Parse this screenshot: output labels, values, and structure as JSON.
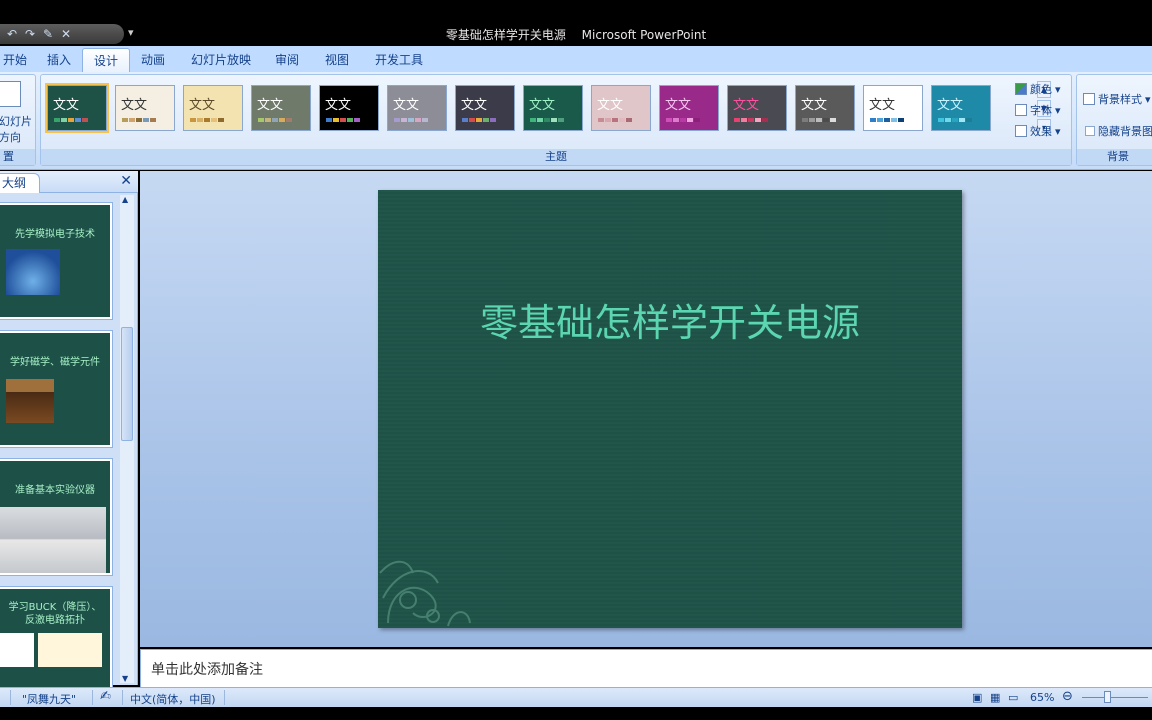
{
  "window": {
    "title_doc": "零基础怎样学开关电源",
    "title_app": "Microsoft PowerPoint"
  },
  "qat": {
    "buttons": [
      "↶",
      "↷",
      "✎",
      "✕"
    ],
    "more": "▾"
  },
  "tabs": [
    "开始",
    "插入",
    "设计",
    "动画",
    "幻灯片放映",
    "审阅",
    "视图",
    "开发工具"
  ],
  "active_tab": "设计",
  "ribbon": {
    "page_setup": {
      "label": "置",
      "button_line1": "幻灯片",
      "button_line2": "方向"
    },
    "themes": {
      "label": "主题",
      "items": [
        {
          "text": "文文",
          "bg": "#1e5247",
          "fg": "#fff",
          "colors": [
            "#39a36c",
            "#7fd1a6",
            "#e4a33c",
            "#5a8fd4",
            "#c04f4f"
          ]
        },
        {
          "text": "文文",
          "bg": "#f4efe2",
          "fg": "#333",
          "colors": [
            "#b89c5c",
            "#cfa46e",
            "#8a6d3b",
            "#7a9bb8",
            "#a67b4f"
          ]
        },
        {
          "text": "文文",
          "bg": "#f3e3b0",
          "fg": "#5a4a2a",
          "colors": [
            "#c9963f",
            "#d7b066",
            "#a77a2c",
            "#e5c17b",
            "#8f6a2d"
          ]
        },
        {
          "text": "文文",
          "bg": "#6f7a6a",
          "fg": "#fff",
          "colors": [
            "#a7c76a",
            "#c5b47a",
            "#8fa5b4",
            "#d4ae5e",
            "#a37d6b"
          ]
        },
        {
          "text": "文文",
          "bg": "#000000",
          "fg": "#fff",
          "colors": [
            "#3d7ac9",
            "#e6c02f",
            "#d04f4f",
            "#57b357",
            "#a45fc4"
          ]
        },
        {
          "text": "文文",
          "bg": "#8d8d98",
          "fg": "#fff",
          "colors": [
            "#a69ccf",
            "#c7b5d6",
            "#9ec0d8",
            "#d7a6c3",
            "#b7b7d0"
          ]
        },
        {
          "text": "文文",
          "bg": "#3b3b4a",
          "fg": "#fff",
          "colors": [
            "#5a7ec9",
            "#d44c4c",
            "#e6a93c",
            "#6cb06c",
            "#8c6cbc"
          ]
        },
        {
          "text": "文文",
          "bg": "#1a5a4a",
          "fg": "#9ef2c5",
          "colors": [
            "#3fb57d",
            "#6fd4a3",
            "#2f8a63",
            "#9fe0bd",
            "#4f9f7f"
          ]
        },
        {
          "text": "文文",
          "bg": "#e0c6c9",
          "fg": "#fff",
          "colors": [
            "#c98b93",
            "#d6a7ad",
            "#b8737f",
            "#e1b9be",
            "#a96a74"
          ]
        },
        {
          "text": "文文",
          "bg": "#9a2a8a",
          "fg": "#f5c6ef",
          "colors": [
            "#d04fb8",
            "#e07acc",
            "#b83aa3",
            "#f0a3de",
            "#8c1f7a"
          ]
        },
        {
          "text": "文文",
          "bg": "#4a4a52",
          "fg": "#ff4fa0",
          "colors": [
            "#e6416f",
            "#f07ca0",
            "#c93a60",
            "#f5a5c0",
            "#a82e50"
          ]
        },
        {
          "text": "文文",
          "bg": "#5a5a5a",
          "fg": "#fff",
          "colors": [
            "#7c7c7c",
            "#9c9c9c",
            "#bcbcbc",
            "#4c4c4c",
            "#dcdcdc"
          ]
        },
        {
          "text": "文文",
          "bg": "#ffffff",
          "fg": "#333",
          "colors": [
            "#2f7ec9",
            "#4ba3d9",
            "#1d5f9e",
            "#7fc1e6",
            "#0d4075"
          ]
        },
        {
          "text": "文文",
          "bg": "#1e8aa8",
          "fg": "#c8f4ff",
          "colors": [
            "#3fc5e0",
            "#6fd9ec",
            "#2aa3bf",
            "#9fe7f4",
            "#1b7d96"
          ]
        }
      ],
      "colors_label": "颜色",
      "fonts_label": "字体",
      "effects_label": "效果"
    },
    "background": {
      "label": "背景",
      "styles_label": "背景样式",
      "hide_label": "隐藏背景图"
    }
  },
  "outline_pane": {
    "tab_label": "大纲",
    "close": "✕",
    "slides": [
      {
        "title": "先学模拟电子技术"
      },
      {
        "title": "学好磁学、磁学元件"
      },
      {
        "title": "准备基本实验仪器"
      },
      {
        "title": "学习BUCK（降压）、反激电路拓扑"
      }
    ]
  },
  "slide": {
    "title": "零基础怎样学开关电源"
  },
  "notes": {
    "placeholder": "单击此处添加备注"
  },
  "status": {
    "theme_name": "\"凤舞九天\"",
    "language": "中文(简体，中国)",
    "zoom": "65%"
  }
}
